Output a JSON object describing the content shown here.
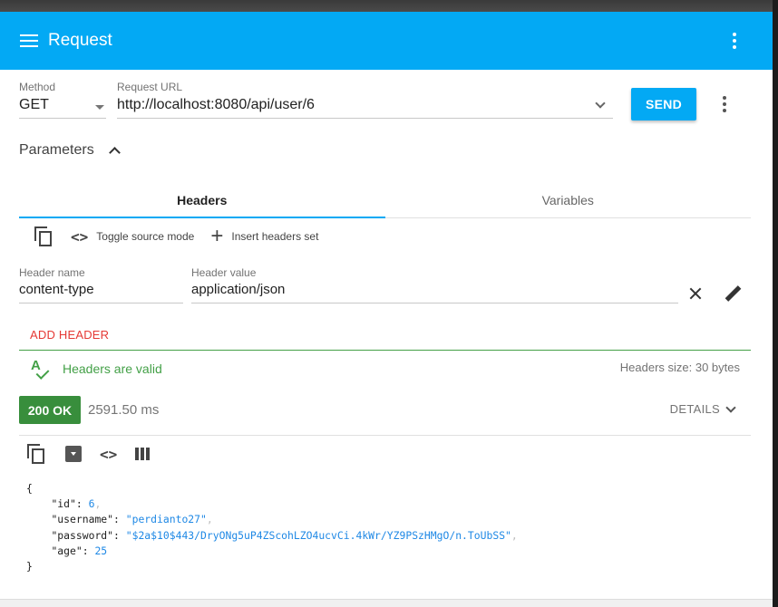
{
  "toolbar": {
    "title": "Request"
  },
  "request": {
    "method_label": "Method",
    "method": "GET",
    "url_label": "Request URL",
    "url": "http://localhost:8080/api/user/6",
    "send_label": "SEND"
  },
  "parameters": {
    "label": "Parameters"
  },
  "tabs": [
    {
      "label": "Headers",
      "active": true
    },
    {
      "label": "Variables",
      "active": false
    }
  ],
  "header_tools": {
    "toggle_source": "Toggle source mode",
    "insert_headers": "Insert headers set"
  },
  "header_row": {
    "name_label": "Header name",
    "name_value": "content-type",
    "value_label": "Header value",
    "value_value": "application/json"
  },
  "add_header_label": "ADD HEADER",
  "validation": {
    "status": "Headers are valid",
    "size": "Headers size: 30 bytes"
  },
  "response": {
    "status": "200 OK",
    "time": "2591.50 ms",
    "details_label": "DETAILS",
    "body": {
      "open": "{",
      "close": "}",
      "fields": [
        {
          "key": "\"id\"",
          "value": "6",
          "type": "number",
          "comma": true
        },
        {
          "key": "\"username\"",
          "value": "\"perdianto27\"",
          "type": "string",
          "comma": true
        },
        {
          "key": "\"password\"",
          "value": "\"$2a$10$443/DryONg5uP4ZScohLZO4ucvCi.4kWr/YZ9PSzHMgO/n.ToUbSS\"",
          "type": "string",
          "comma": true
        },
        {
          "key": "\"age\"",
          "value": "25",
          "type": "number",
          "comma": false
        }
      ]
    }
  },
  "colors": {
    "accent": "#03a9f4",
    "success": "#43a047",
    "status_badge": "#388e3c",
    "error": "#e53935"
  },
  "icons": [
    "menu-icon",
    "more-vert-icon",
    "chevron-down-icon",
    "chevron-up-icon",
    "copy-icon",
    "code-icon",
    "plus-icon",
    "close-icon",
    "edit-icon",
    "spellcheck-icon",
    "save-icon",
    "view-column-icon"
  ]
}
